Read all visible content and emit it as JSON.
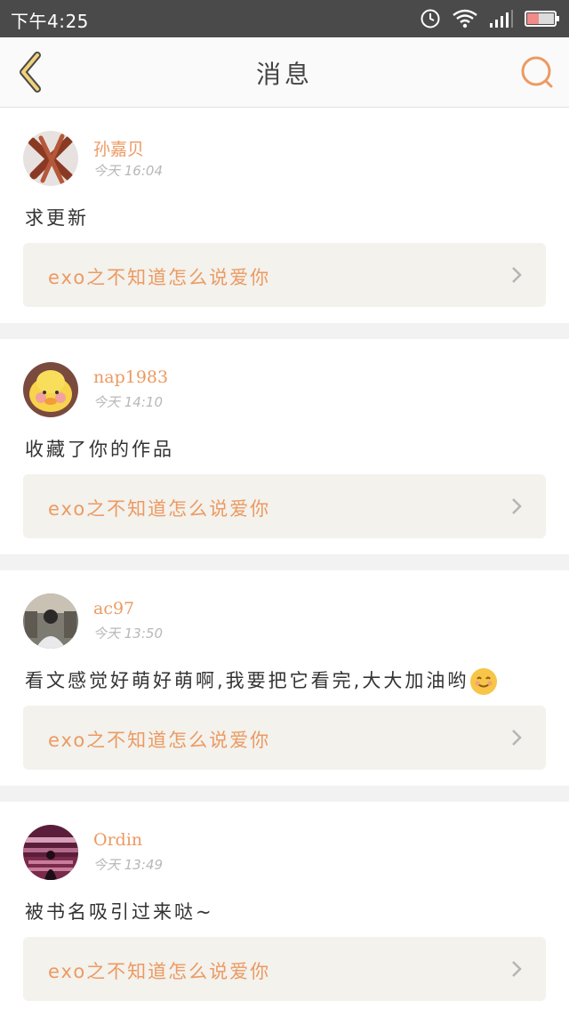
{
  "status": {
    "time": "下午4:25"
  },
  "header": {
    "title": "消息"
  },
  "messages": [
    {
      "username": "孙嘉贝",
      "time": "今天 16:04",
      "comment": "求更新",
      "work_title": "exo之不知道怎么说爱你"
    },
    {
      "username": "nap1983",
      "time": "今天 14:10",
      "comment": "收藏了你的作品",
      "work_title": "exo之不知道怎么说爱你"
    },
    {
      "username": "ac97",
      "time": "今天 13:50",
      "comment": "看文感觉好萌好萌啊,我要把它看完,大大加油哟",
      "work_title": "exo之不知道怎么说爱你"
    },
    {
      "username": "Ordin",
      "time": "今天 13:49",
      "comment": "被书名吸引过来哒~",
      "work_title": "exo之不知道怎么说爱你"
    }
  ],
  "colors": {
    "accent": "#ec9a62",
    "status_bar": "#4a4a4a",
    "link_bg": "#f3f2ed"
  },
  "icons": [
    "back-arrow-icon",
    "search-icon",
    "alarm-icon",
    "wifi-icon",
    "signal-icon",
    "battery-icon",
    "chevron-right-icon",
    "smile-emoji-icon"
  ]
}
